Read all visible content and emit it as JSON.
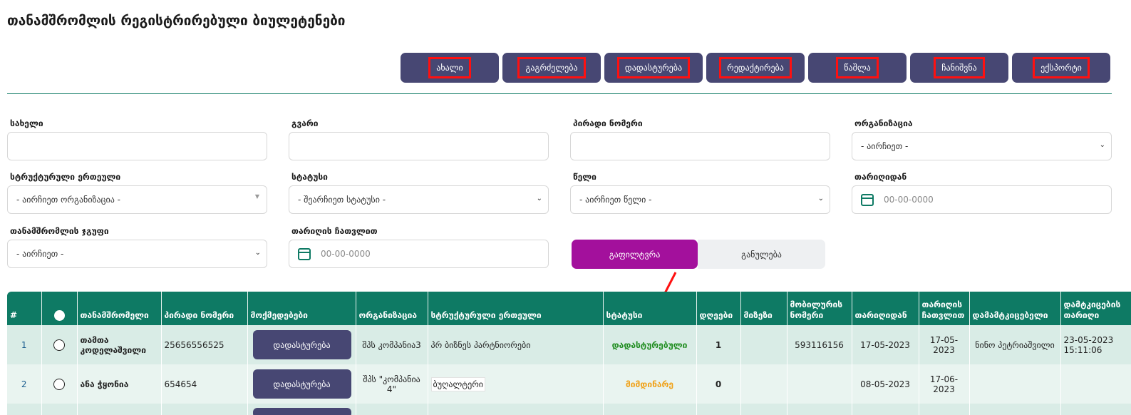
{
  "page": {
    "title": "თანამშრომლის რეგისტრირებული ბიულეტენები"
  },
  "toolbar": {
    "buttons": [
      "ახალი",
      "გაგრძელება",
      "დადასტურება",
      "რედაქტირება",
      "წაშლა",
      "ჩანიშვნა",
      "ექსპორტი"
    ],
    "highlight_color": "#ff1010",
    "button_color": "#474773"
  },
  "filters": {
    "name": {
      "label": "სახელი",
      "value": ""
    },
    "surname": {
      "label": "გვარი",
      "value": ""
    },
    "personal_number": {
      "label": "პირადი ნომერი",
      "value": ""
    },
    "organization": {
      "label": "ორგანიზაცია",
      "selected": "- აირჩიეთ -"
    },
    "structural_unit": {
      "label": "სტრუქტურული ერთეული",
      "selected": "- აირჩიეთ ორგანიზაცია -"
    },
    "status": {
      "label": "სტატუსი",
      "selected": "- შეარჩიეთ სტატუსი -"
    },
    "year": {
      "label": "წელი",
      "selected": "- აირჩიეთ წელი -"
    },
    "date_from": {
      "label": "თარიღიდან",
      "placeholder": "00-00-0000"
    },
    "employee_group": {
      "label": "თანამშრომლის ჯგუფი",
      "selected": "- აირჩიეთ -"
    },
    "date_to": {
      "label": "თარიღის ჩათვლით",
      "placeholder": "00-00-0000"
    },
    "filter_button": "გაფილტვრა",
    "reset_button": "განულება"
  },
  "table": {
    "headers": [
      "#",
      "",
      "თანამშრომელი",
      "პირადი ნომერი",
      "მოქმედებები",
      "ორგანიზაცია",
      "სტრუქტურული ერთეული",
      "სტატუსი",
      "დღეები",
      "მიზეზი",
      "მობილურის ნომერი",
      "თარიღიდან",
      "თარიღის ჩათვლით",
      "დამამტკიცებელი",
      "დამტკიცების თარიღი"
    ],
    "rows": [
      {
        "index": "1",
        "employee": "თამთა კოდელაშვილი",
        "personal_number": "25656556525",
        "action": "დადასტურება",
        "organization": "შპს კომპანია3",
        "structural_unit": "პრ ბიზნეს პარტნიორები",
        "status": "დადასტურებული",
        "days": "1",
        "reason": "",
        "mobile": "593116156",
        "date_from": "17-05-2023",
        "date_to": "17-05-2023",
        "approver": "ნინო პეტრიაშვილი",
        "approval_date": "23-05-2023 15:11:06"
      },
      {
        "index": "2",
        "employee": "ანა ჭყონია",
        "personal_number": "654654",
        "action": "დადასტურება",
        "organization": "შპს \"კომპანია 4\"",
        "structural_unit": "ბუღალტერი",
        "status": "მიმდინარე",
        "days": "0",
        "reason": "",
        "mobile": "",
        "date_from": "08-05-2023",
        "date_to": "17-06-2023",
        "approver": "",
        "approval_date": ""
      }
    ],
    "colors": {
      "header": "#0e7a64",
      "status_ok": "#1e8c1e",
      "status_pending": "#f0a21a"
    }
  },
  "annotation": {
    "color": "#ff1010"
  }
}
